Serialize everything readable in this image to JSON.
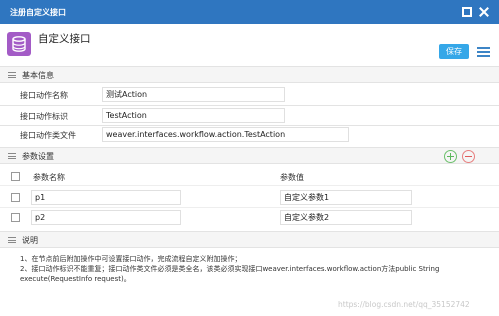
{
  "window": {
    "title": "注册自定义接口",
    "maximize_icon": "maximize-icon",
    "close_icon": "close-icon"
  },
  "header": {
    "icon": "database-icon",
    "title": "自定义接口",
    "save_label": "保存",
    "menu_icon": "list-menu-icon",
    "accent": "#35a7e8"
  },
  "basic_info": {
    "section_label": "基本信息",
    "fields": [
      {
        "label": "接口动作名称",
        "value": "测试Action"
      },
      {
        "label": "接口动作标识",
        "value": "TestAction"
      },
      {
        "label": "接口动作类文件",
        "value": "weaver.interfaces.workflow.action.TestAction"
      }
    ]
  },
  "params": {
    "section_label": "参数设置",
    "columns": [
      "参数名称",
      "参数值"
    ],
    "rows": [
      {
        "name": "p1",
        "value": "自定义参数1"
      },
      {
        "name": "p2",
        "value": "自定义参数2"
      }
    ]
  },
  "description": {
    "section_label": "说明",
    "lines": [
      "1、在节点前后附加操作中可设置接口动作，完成流程自定义附加操作；",
      "2、接口动作标识不能重复；接口动作类文件必须是类全名，该类必须实现接口weaver.interfaces.workflow.action方法public String execute(RequestInfo request)。"
    ]
  },
  "watermark": "https://blog.csdn.net/qq_35152742",
  "colors": {
    "titlebar": "#2f76c0",
    "app_icon": "#a35bc6",
    "add": "#5bb75b",
    "remove": "#e05a5a"
  }
}
